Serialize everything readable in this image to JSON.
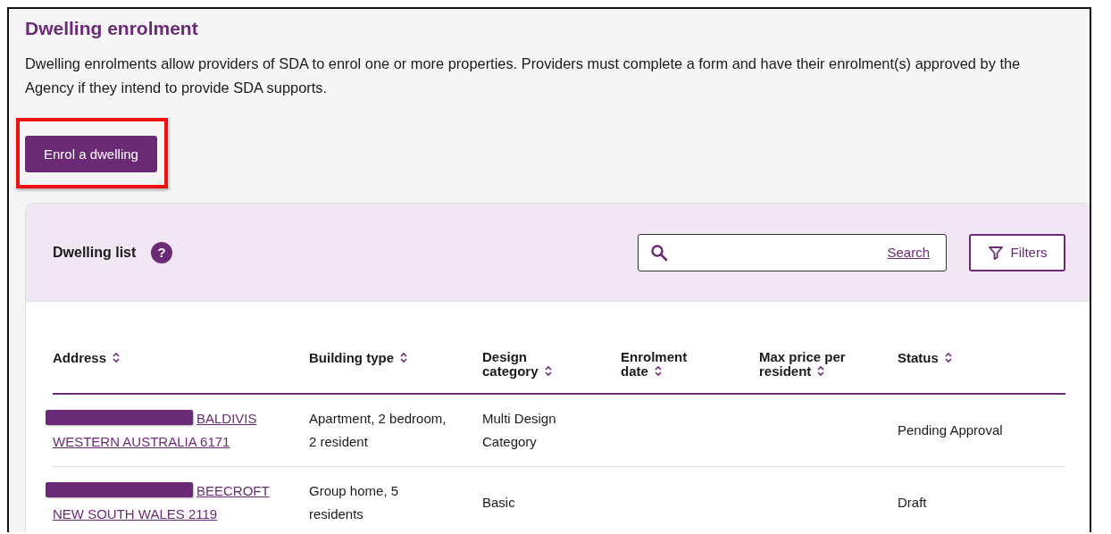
{
  "page": {
    "title": "Dwelling enrolment",
    "intro": "Dwelling enrolments allow providers of SDA to enrol one or more properties. Providers must complete a form and have their enrolment(s) approved by the Agency if they intend to provide SDA supports."
  },
  "enrol_button": {
    "label": "Enrol a dwelling",
    "highlighted": true
  },
  "dwelling_list": {
    "title": "Dwelling list",
    "help_glyph": "?",
    "search": {
      "link": "Search"
    },
    "filters_button": "Filters",
    "columns": [
      {
        "label": "Address",
        "sortable": true
      },
      {
        "label": "Building type",
        "sortable": true
      },
      {
        "label": "Design category",
        "sortable": true
      },
      {
        "label": "Enrolment date",
        "sortable": true
      },
      {
        "label": "Max price per resident",
        "sortable": true
      },
      {
        "label": "Status",
        "sortable": true
      }
    ],
    "rows": [
      {
        "address": "BALDIVIS WESTERN AUSTRALIA 6171",
        "address_redacted": true,
        "building_type": "Apartment, 2 bedroom, 2 resident",
        "design_category": "Multi Design Category",
        "status": "Pending Approval"
      },
      {
        "address": "BEECROFT NEW SOUTH WALES 2119",
        "address_redacted": true,
        "building_type": "Group home, 5 residents",
        "design_category": "Basic",
        "status": "Draft"
      }
    ]
  }
}
